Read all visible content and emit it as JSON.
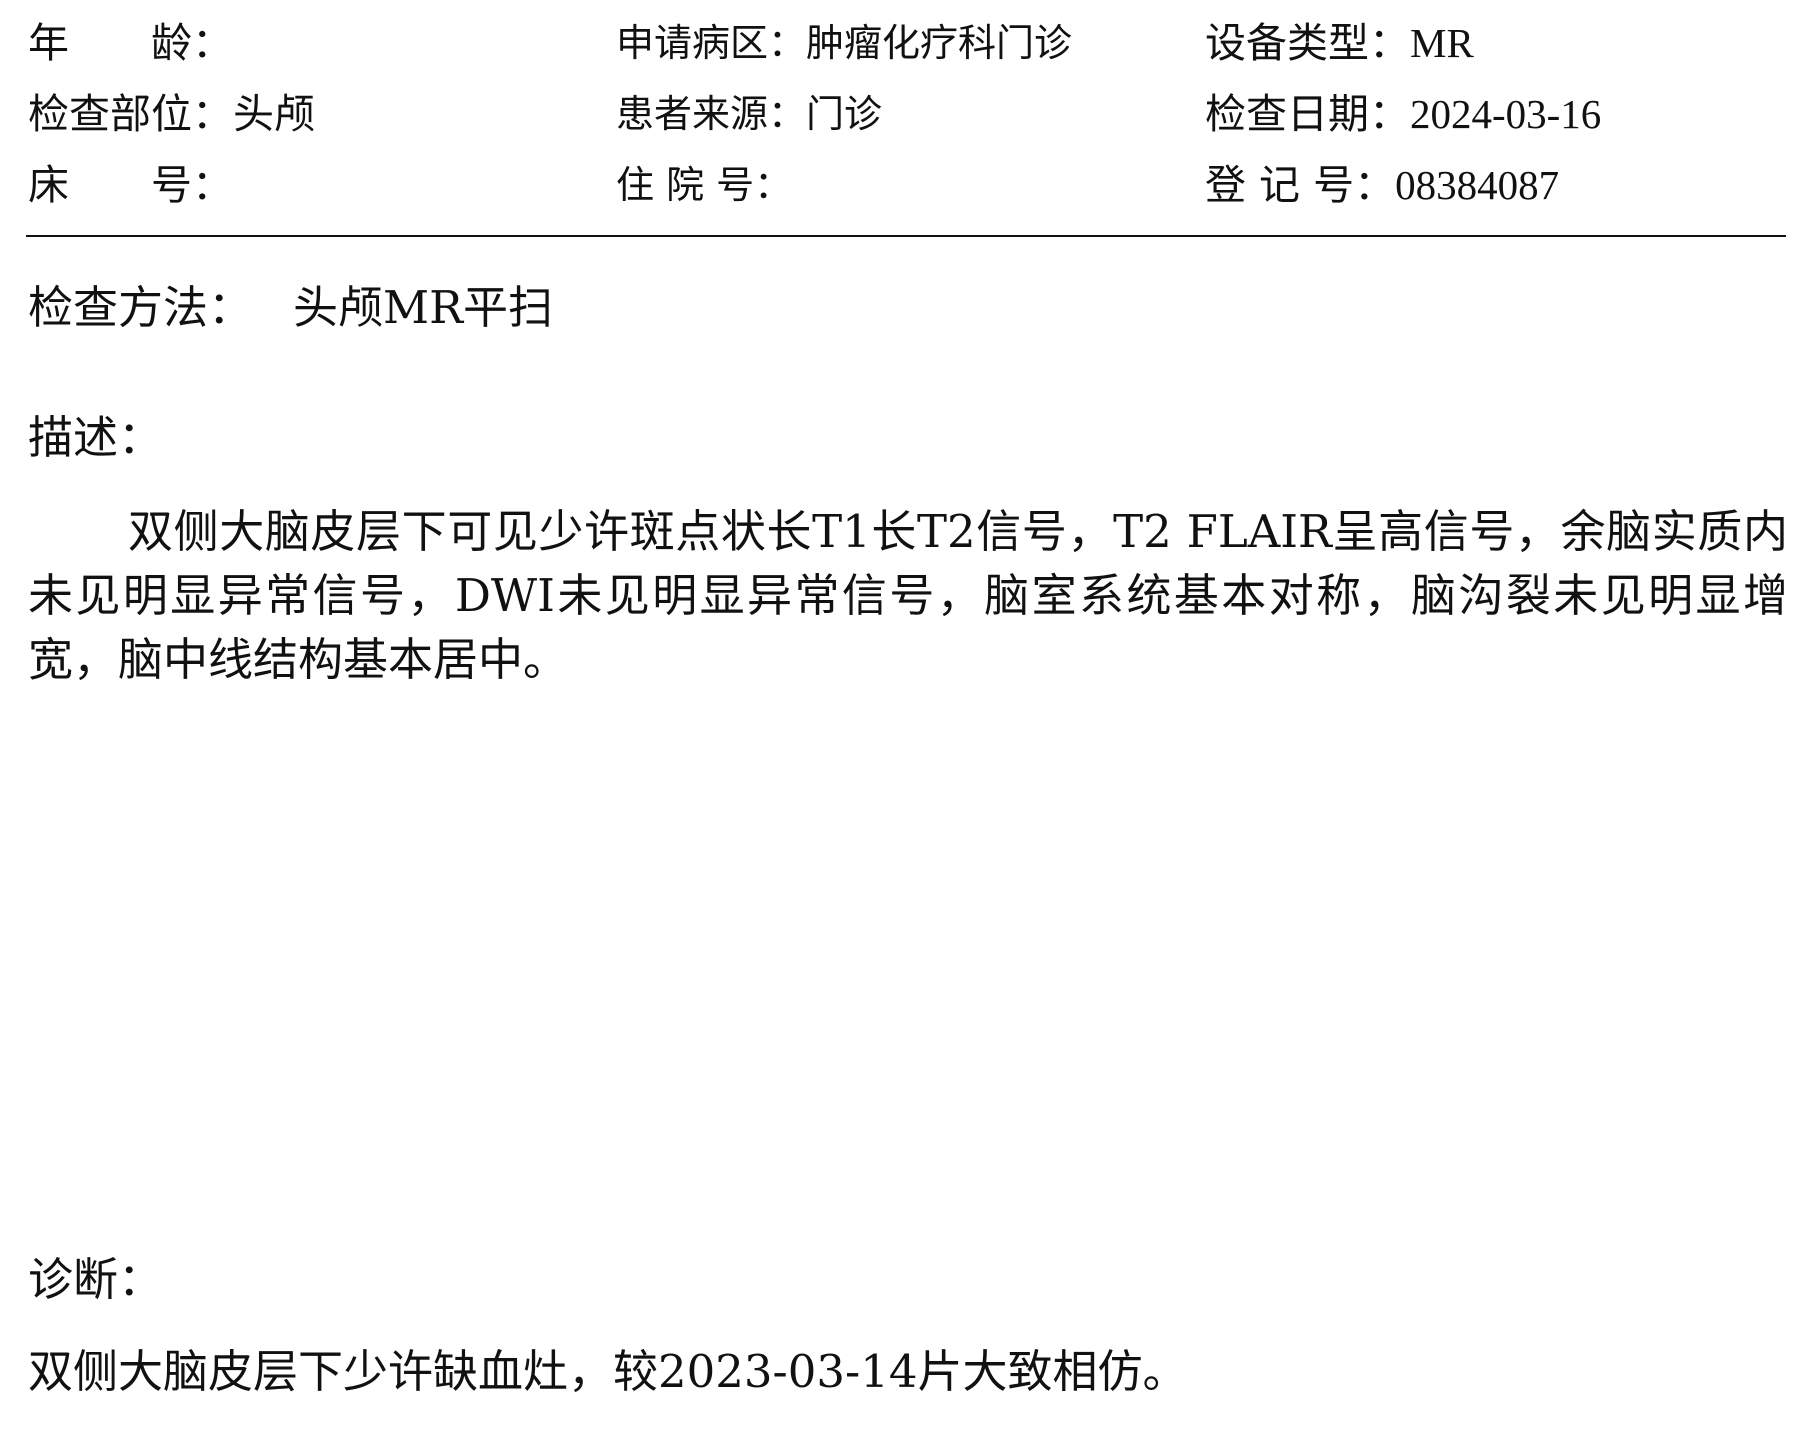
{
  "header": {
    "rows": [
      [
        {
          "label": "年　　龄：",
          "value": ""
        },
        {
          "label": "申请病区：",
          "value": "肿瘤化疗科门诊"
        },
        {
          "label": "设备类型：",
          "value": "MR"
        }
      ],
      [
        {
          "label": "检查部位：",
          "value": "头颅"
        },
        {
          "label": "患者来源：",
          "value": "门诊"
        },
        {
          "label": "检查日期：",
          "value": "2024-03-16"
        }
      ],
      [
        {
          "label": "床　　号：",
          "value": ""
        },
        {
          "label": "住 院 号：",
          "value": ""
        },
        {
          "label": "登 记 号：",
          "value": "08384087"
        }
      ]
    ]
  },
  "method": {
    "label": "检查方法：",
    "value": "头颅MR平扫"
  },
  "description": {
    "title": "描述：",
    "text": "双侧大脑皮层下可见少许斑点状长T1长T2信号，T2 FLAIR呈高信号，余脑实质内未见明显异常信号，DWI未见明显异常信号，脑室系统基本对称，脑沟裂未见明显增宽，脑中线结构基本居中。"
  },
  "diagnosis": {
    "title": "诊断：",
    "text": "双侧大脑皮层下少许缺血灶，较2023-03-14片大致相仿。"
  }
}
